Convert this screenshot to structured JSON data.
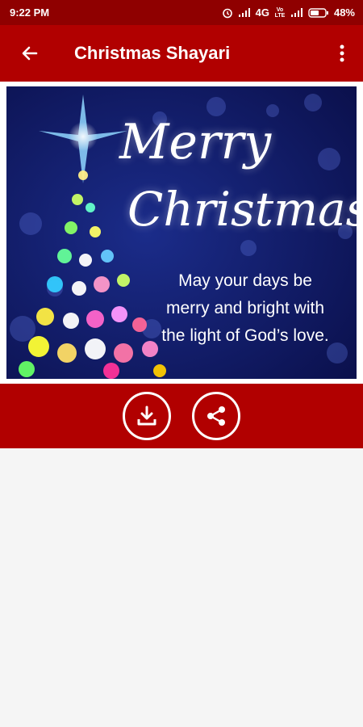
{
  "status": {
    "time": "9:22 PM",
    "network": "4G",
    "volte": "Vo LTE",
    "battery": "48%"
  },
  "app_bar": {
    "title": "Christmas Shayari"
  },
  "card": {
    "title_line1": "Merry",
    "title_line2": "Christmas",
    "message_line1": "May your days be",
    "message_line2": "merry and bright with",
    "message_line3": "the light of God’s love."
  },
  "icons": [
    "back-arrow-icon",
    "more-vert-icon",
    "download-icon",
    "share-icon",
    "alarm-icon",
    "signal-icon",
    "battery-icon"
  ],
  "colors": {
    "status_bar": "#8f0000",
    "app_bar": "#b10000",
    "card_bg": "#0b1a5c"
  }
}
